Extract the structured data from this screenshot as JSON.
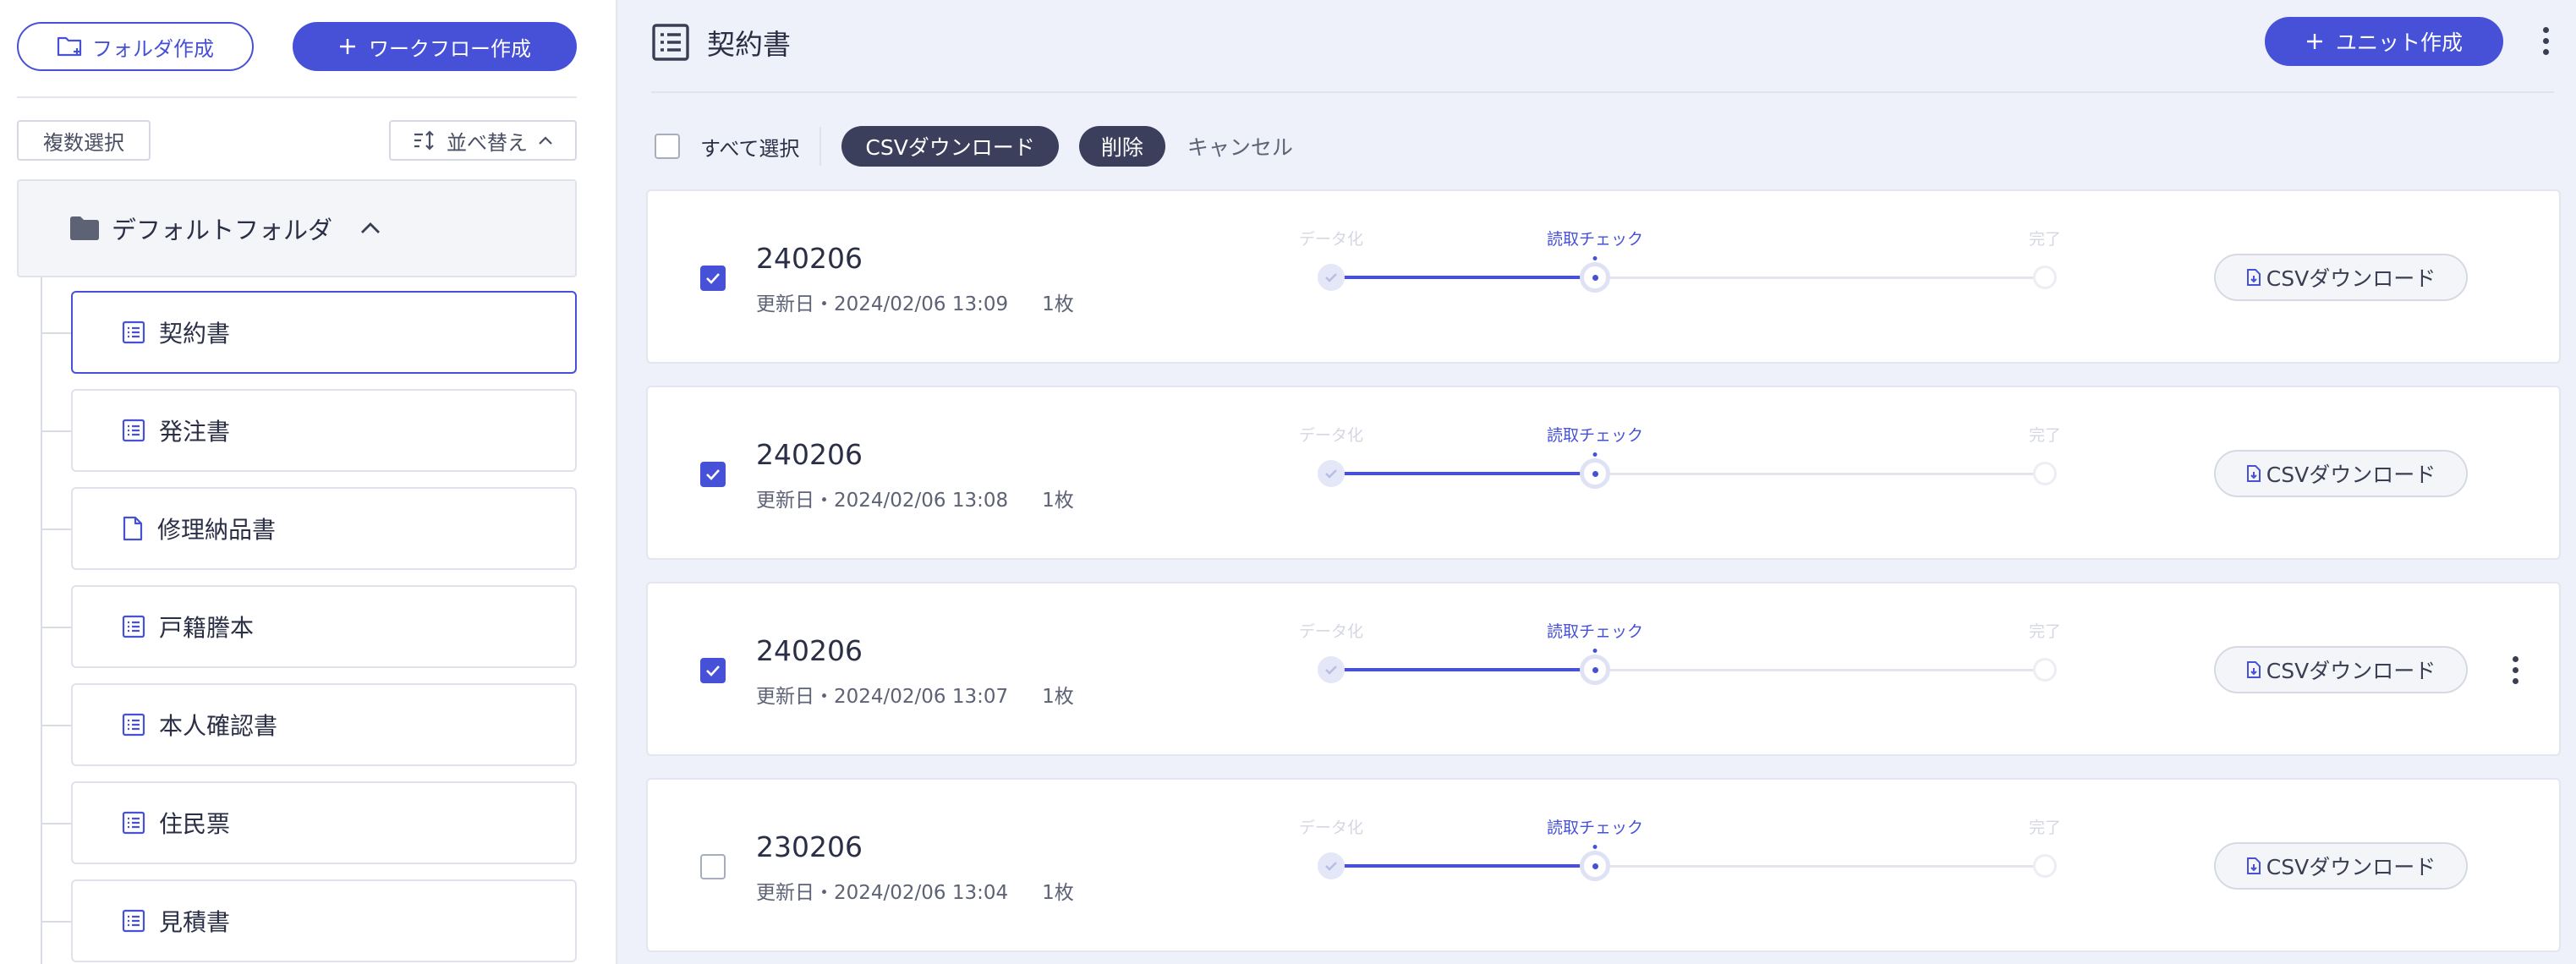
{
  "sidebar": {
    "create_folder_label": "フォルダ作成",
    "create_workflow_label": "ワークフロー作成",
    "multi_select_label": "複数選択",
    "sort_label": "並べ替え",
    "folder": {
      "name": "デフォルトフォルダ"
    },
    "units": [
      {
        "label": "契約書",
        "icon": "list-icon",
        "active": true
      },
      {
        "label": "発注書",
        "icon": "list-icon"
      },
      {
        "label": "修理納品書",
        "icon": "document-icon"
      },
      {
        "label": "戸籍謄本",
        "icon": "list-icon"
      },
      {
        "label": "本人確認書",
        "icon": "list-icon"
      },
      {
        "label": "住民票",
        "icon": "list-icon"
      },
      {
        "label": "見積書",
        "icon": "list-icon"
      }
    ]
  },
  "main": {
    "title": "契約書",
    "create_unit_label": "ユニット作成",
    "toolbar": {
      "select_all_label": "すべて選択",
      "csv_download_label": "CSVダウンロード",
      "delete_label": "削除",
      "cancel_label": "キャンセル"
    },
    "steps": [
      "データ化",
      "読取チェック",
      "完了"
    ],
    "current_step": "読取チェック",
    "csv_button_label": "CSVダウンロード",
    "rows": [
      {
        "name": "240206",
        "updated": "更新日・2024/02/06 13:09",
        "pages": "1枚",
        "checked": true
      },
      {
        "name": "240206",
        "updated": "更新日・2024/02/06 13:08",
        "pages": "1枚",
        "checked": true
      },
      {
        "name": "240206",
        "updated": "更新日・2024/02/06 13:07",
        "pages": "1枚",
        "checked": true,
        "has_menu": true
      },
      {
        "name": "230206",
        "updated": "更新日・2024/02/06 13:04",
        "pages": "1枚",
        "checked": false
      }
    ]
  },
  "colors": {
    "accent": "#4751d8",
    "dark_chip": "#3b3f5c",
    "background": "#eef1f9"
  }
}
